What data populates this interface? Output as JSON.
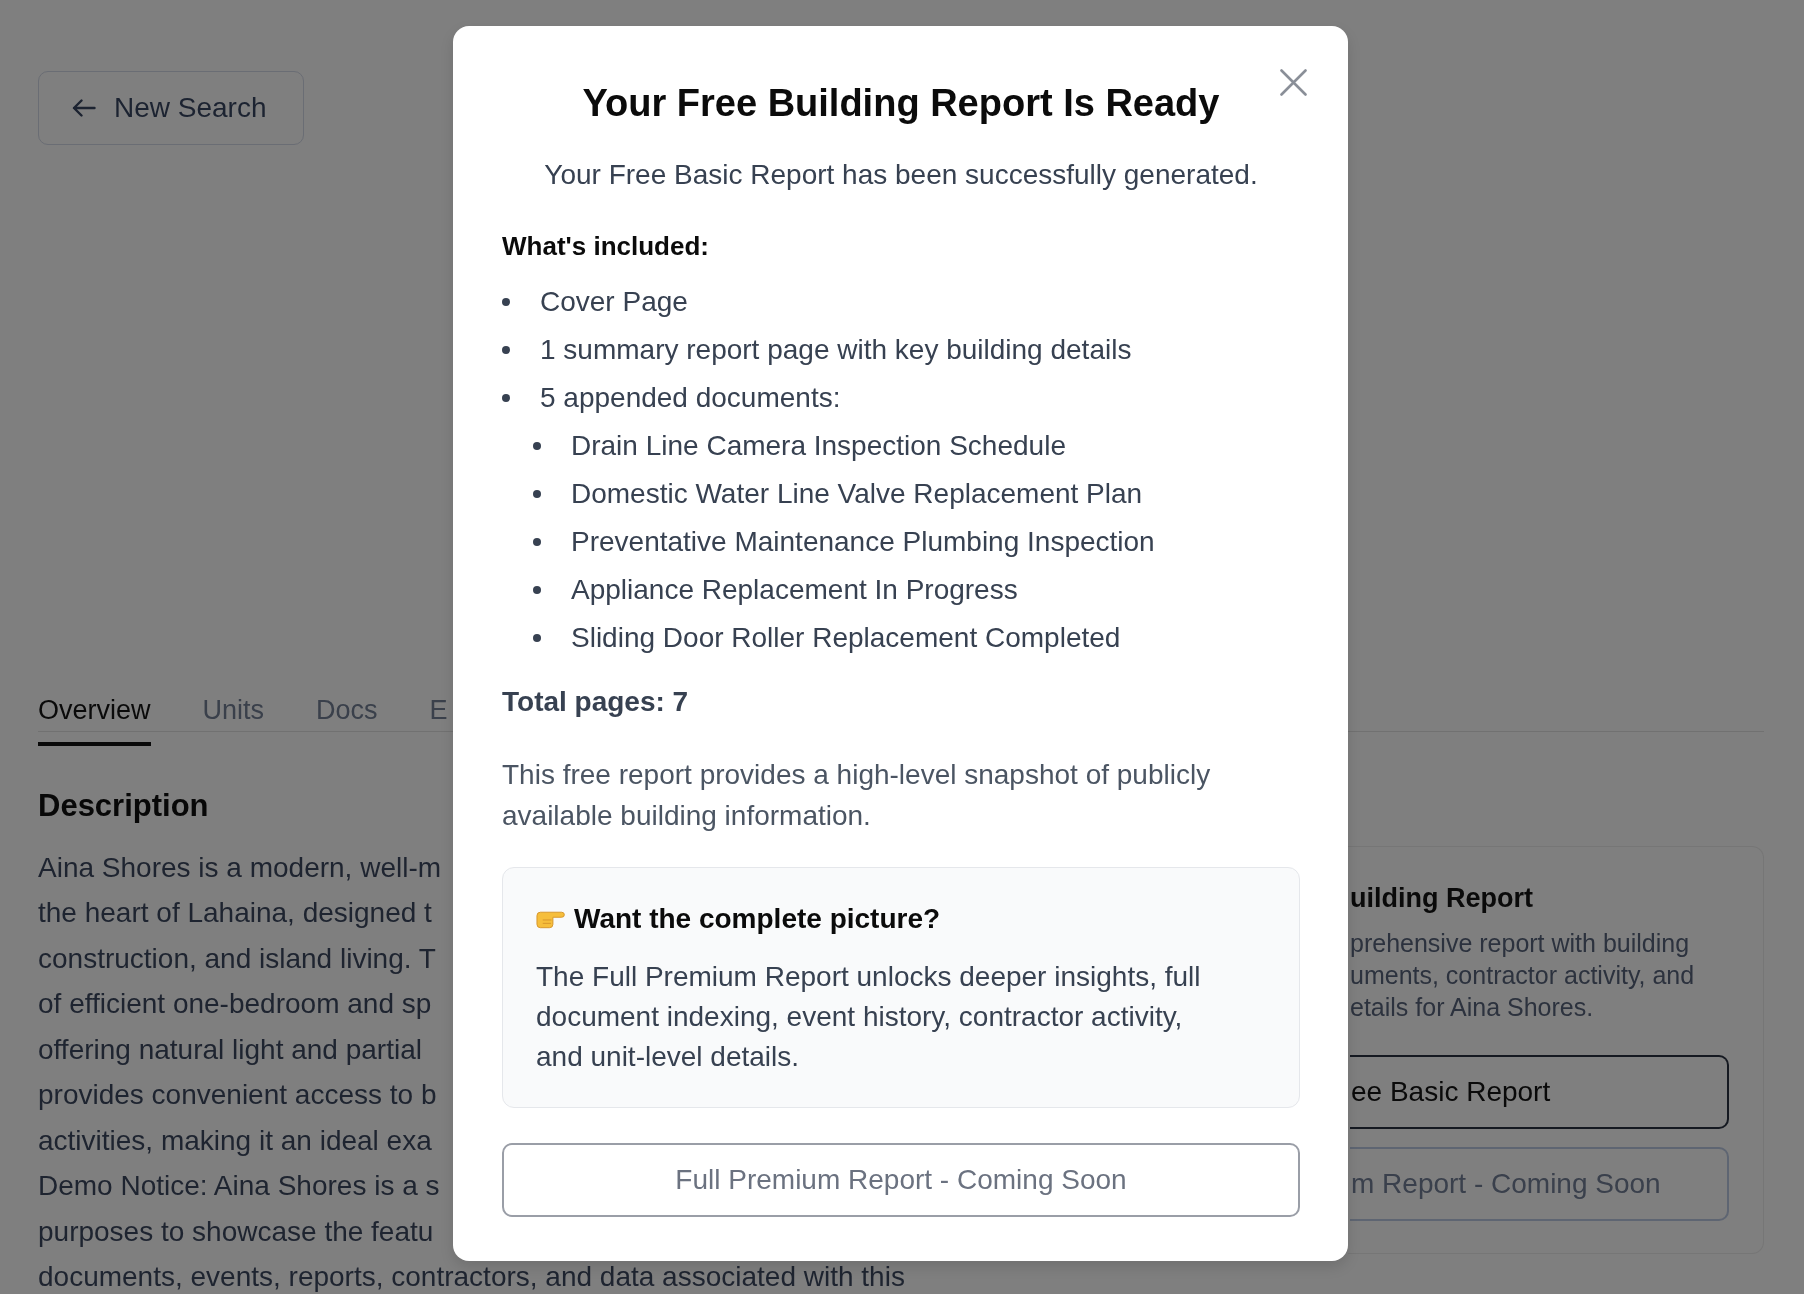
{
  "page": {
    "back_button": {
      "label": "New Search"
    },
    "tabs": [
      {
        "label": "Overview",
        "selected": true
      },
      {
        "label": "Units",
        "selected": false
      },
      {
        "label": "Docs",
        "selected": false
      },
      {
        "label": "E",
        "selected": false
      }
    ],
    "description": {
      "heading": "Description",
      "lines": [
        "Aina Shores is a modern, well-m",
        "the heart of Lahaina, designed t",
        "construction, and island living. T",
        "of efficient one-bedroom and sp",
        "offering natural light and partial",
        "provides convenient access to b",
        "activities, making it an ideal exa",
        "Demo Notice: Aina Shores is a s",
        "purposes to showcase the featu",
        "documents, events, reports, contractors, and data associated with this"
      ]
    },
    "report_card": {
      "heading": "uilding Report",
      "lines": [
        "prehensive report with building",
        "uments, contractor activity, and",
        "etails for Aina Shores."
      ],
      "buttons": [
        {
          "label": "ee Basic Report",
          "disabled": false
        },
        {
          "label": "m Report - Coming Soon",
          "disabled": true
        }
      ]
    }
  },
  "modal": {
    "title": "Your Free Building Report Is Ready",
    "subtitle": "Your Free Basic Report has been successfully generated.",
    "included_heading": "What's included:",
    "items": [
      {
        "text": "Cover Page"
      },
      {
        "text": "1 summary report page with key building details"
      },
      {
        "text": "5 appended documents:",
        "children": [
          {
            "text": "Drain Line Camera Inspection Schedule"
          },
          {
            "text": "Domestic Water Line Valve Replacement Plan"
          },
          {
            "text": "Preventative Maintenance Plumbing Inspection"
          },
          {
            "text": "Appliance Replacement In Progress"
          },
          {
            "text": "Sliding Door Roller Replacement Completed"
          }
        ]
      }
    ],
    "total_pages": "Total pages: 7",
    "note": "This free report provides a high-level snapshot of publicly available building information.",
    "callout": {
      "heading": "Want the complete picture?",
      "text": "The Full Premium Report unlocks deeper insights, full document indexing, event history, contractor activity, and unit-level details."
    },
    "button": {
      "label": "Full Premium Report - Coming Soon",
      "disabled": true
    }
  }
}
